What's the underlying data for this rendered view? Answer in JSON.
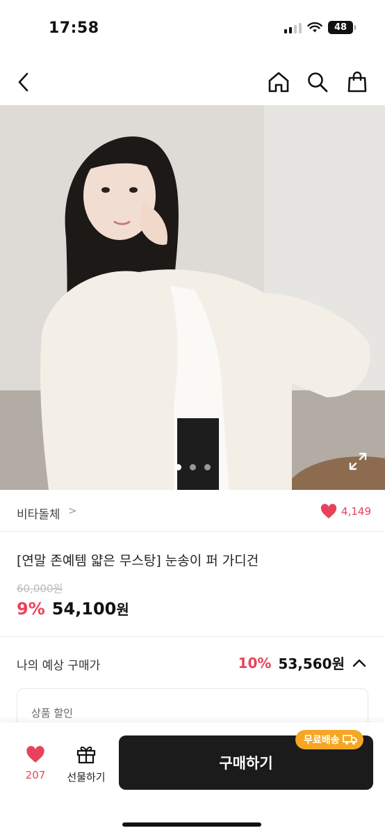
{
  "status": {
    "time": "17:58",
    "battery": "48"
  },
  "brand": {
    "name": "비타돌체",
    "chevron": ">",
    "likes": "4,149"
  },
  "product": {
    "title": "[연말 존예템 얇은 무스탕] 눈송이 퍼 가디건",
    "original_price": "60,000원",
    "discount": "9%",
    "price": "54,100",
    "price_unit": "원"
  },
  "expected": {
    "label": "나의 예상 구매가",
    "rate": "10%",
    "price": "53,560원"
  },
  "discount_box": {
    "label": "상품 할인"
  },
  "gallery": {
    "total": 3,
    "current": 1
  },
  "bottom": {
    "wish_count": "207",
    "gift_label": "선물하기",
    "buy_label": "구매하기",
    "shipping_badge": "무료배송"
  },
  "colors": {
    "accent": "#e9425b",
    "badge": "#f6a623",
    "buy_button": "#1b1b1b"
  }
}
